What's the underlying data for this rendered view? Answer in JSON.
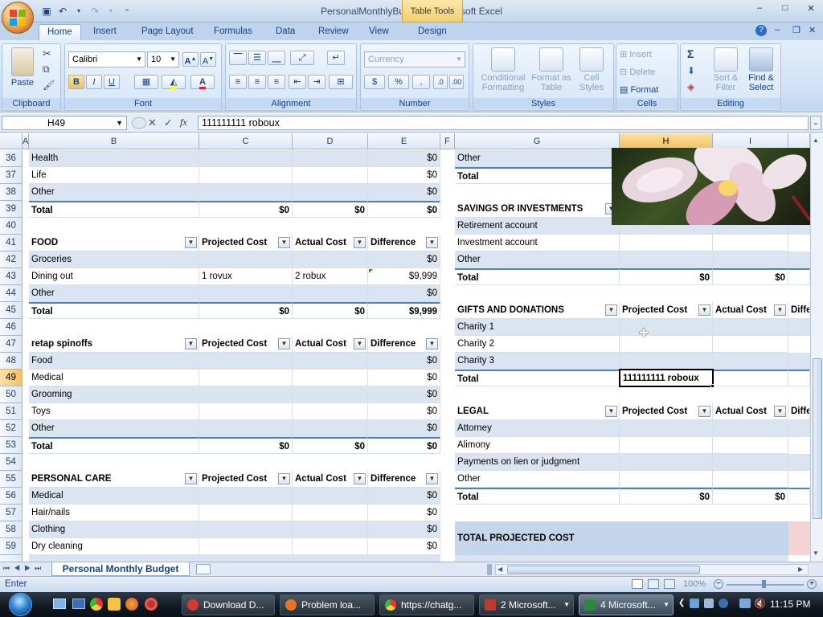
{
  "window": {
    "title": "PersonalMonthlyBudget1 - Microsoft Excel",
    "context_tab": "Table Tools",
    "controls": {
      "minimize": "–",
      "maximize": "□",
      "close": "✕"
    }
  },
  "ribbon": {
    "tabs": [
      "Home",
      "Insert",
      "Page Layout",
      "Formulas",
      "Data",
      "Review",
      "View",
      "Design"
    ],
    "active_tab": "Home",
    "clipboard": {
      "paste": "Paste",
      "label": "Clipboard"
    },
    "font": {
      "name": "Calibri",
      "size": "10",
      "label": "Font"
    },
    "alignment": {
      "label": "Alignment"
    },
    "number": {
      "format": "Currency",
      "label": "Number"
    },
    "styles": {
      "conditional": "Conditional Formatting",
      "format_table": "Format as Table",
      "cell_styles": "Cell Styles",
      "label": "Styles"
    },
    "cells": {
      "insert": "Insert",
      "delete": "Delete",
      "format": "Format",
      "label": "Cells"
    },
    "editing": {
      "sort": "Sort & Filter",
      "find": "Find & Select",
      "label": "Editing"
    }
  },
  "formula_bar": {
    "name_box": "H49",
    "fx": "fx",
    "content": "111111111 roboux"
  },
  "columns_left": [
    "A",
    "B",
    "C",
    "D",
    "E"
  ],
  "columns_right": [
    "F",
    "G",
    "H",
    "I"
  ],
  "left_sheet": {
    "rows": [
      "36",
      "37",
      "38",
      "39",
      "40",
      "41",
      "42",
      "43",
      "44",
      "45",
      "46",
      "47",
      "48",
      "49",
      "50",
      "51",
      "52",
      "53",
      "54",
      "55",
      "56",
      "57",
      "58",
      "59"
    ],
    "cells": {
      "r36": {
        "b": "Health",
        "e": "$0"
      },
      "r37": {
        "b": "Life",
        "e": "$0"
      },
      "r38": {
        "b": "Other",
        "e": "$0"
      },
      "r39": {
        "b": "Total",
        "c": "$0",
        "d": "$0",
        "e": "$0"
      },
      "r41": {
        "b": "FOOD",
        "c": "Projected Cost",
        "d": "Actual Cost",
        "e": "Difference"
      },
      "r42": {
        "b": "Groceries",
        "e": "$0"
      },
      "r43": {
        "b": "Dining out",
        "c": "1 rovux",
        "d": "2 robux",
        "e": "$9,999"
      },
      "r44": {
        "b": "Other",
        "e": "$0"
      },
      "r45": {
        "b": "Total",
        "c": "$0",
        "d": "$0",
        "e": "$9,999"
      },
      "r47": {
        "b": "retap spinoffs",
        "c": "Projected Cost",
        "d": "Actual Cost",
        "e": "Difference"
      },
      "r48": {
        "b": "Food",
        "e": "$0"
      },
      "r49": {
        "b": "Medical",
        "e": "$0"
      },
      "r50": {
        "b": "Grooming",
        "e": "$0"
      },
      "r51": {
        "b": "Toys",
        "e": "$0"
      },
      "r52": {
        "b": "Other",
        "e": "$0"
      },
      "r53": {
        "b": "Total",
        "c": "$0",
        "d": "$0",
        "e": "$0"
      },
      "r55": {
        "b": "PERSONAL CARE",
        "c": "Projected Cost",
        "d": "Actual Cost",
        "e": "Difference"
      },
      "r56": {
        "b": "Medical",
        "e": "$0"
      },
      "r57": {
        "b": "Hair/nails",
        "e": "$0"
      },
      "r58": {
        "b": "Clothing",
        "e": "$0"
      },
      "r59": {
        "b": "Dry cleaning",
        "e": "$0"
      }
    }
  },
  "right_sheet": {
    "cells": {
      "r36": {
        "g": "Other"
      },
      "r37": {
        "g": "Total"
      },
      "r39": {
        "g": "SAVINGS OR INVESTMENTS"
      },
      "r40": {
        "g": "Retirement account"
      },
      "r41": {
        "g": "Investment account"
      },
      "r42": {
        "g": "Other"
      },
      "r43": {
        "g": "Total",
        "h": "$0",
        "i": "$0"
      },
      "r45": {
        "g": "GIFTS AND DONATIONS",
        "h": "Projected Cost",
        "i": "Actual Cost",
        "j": "Diffe"
      },
      "r46": {
        "g": "Charity 1"
      },
      "r47": {
        "g": "Charity 2"
      },
      "r48": {
        "g": "Charity 3"
      },
      "r49": {
        "g": "Total",
        "h": "111111111 roboux"
      },
      "r51": {
        "g": "LEGAL",
        "h": "Projected Cost",
        "i": "Actual Cost",
        "j": "Diffe"
      },
      "r52": {
        "g": "Attorney"
      },
      "r53": {
        "g": "Alimony"
      },
      "r54": {
        "g": "Payments on lien or judgment"
      },
      "r55": {
        "g": "Other"
      },
      "r56": {
        "g": "Total",
        "h": "$0",
        "i": "$0"
      },
      "r58": {
        "g": "TOTAL PROJECTED COST"
      }
    }
  },
  "sheet_tabs": {
    "active": "Personal Monthly Budget"
  },
  "status": {
    "mode": "Enter",
    "zoom": "100%"
  },
  "taskbar": {
    "items": [
      {
        "label": "Download D...",
        "color": "#d63a2a"
      },
      {
        "label": "Problem loa...",
        "color": "#e8742a"
      },
      {
        "label": "https://chatg...",
        "color": "#3aa14a"
      },
      {
        "label": "2 Microsoft...",
        "color": "#c0392b"
      },
      {
        "label": "4 Microsoft...",
        "color": "#2d8a3a"
      }
    ],
    "clock": "11:15 PM"
  },
  "colors": {
    "band": "#dbe5f1",
    "header_blue": "#15428b",
    "selected_header": "#f3c15f",
    "total_line": "#4f81bd"
  }
}
